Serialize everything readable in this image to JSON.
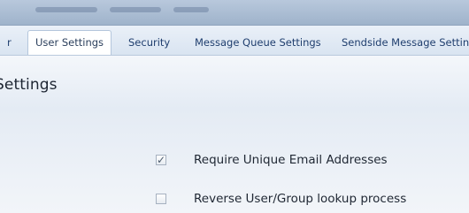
{
  "tabs": [
    {
      "label": "r",
      "active": false
    },
    {
      "label": "User Settings",
      "active": true
    },
    {
      "label": "Security",
      "active": false
    },
    {
      "label": "Message Queue Settings",
      "active": false
    },
    {
      "label": "Sendside Message Setting",
      "active": false
    }
  ],
  "page": {
    "title": "ettings"
  },
  "options": [
    {
      "label": "Require Unique Email Addresses",
      "checked": true
    },
    {
      "label": "Reverse User/Group lookup process",
      "checked": false
    }
  ],
  "icons": {
    "checkmark": "check-icon"
  }
}
